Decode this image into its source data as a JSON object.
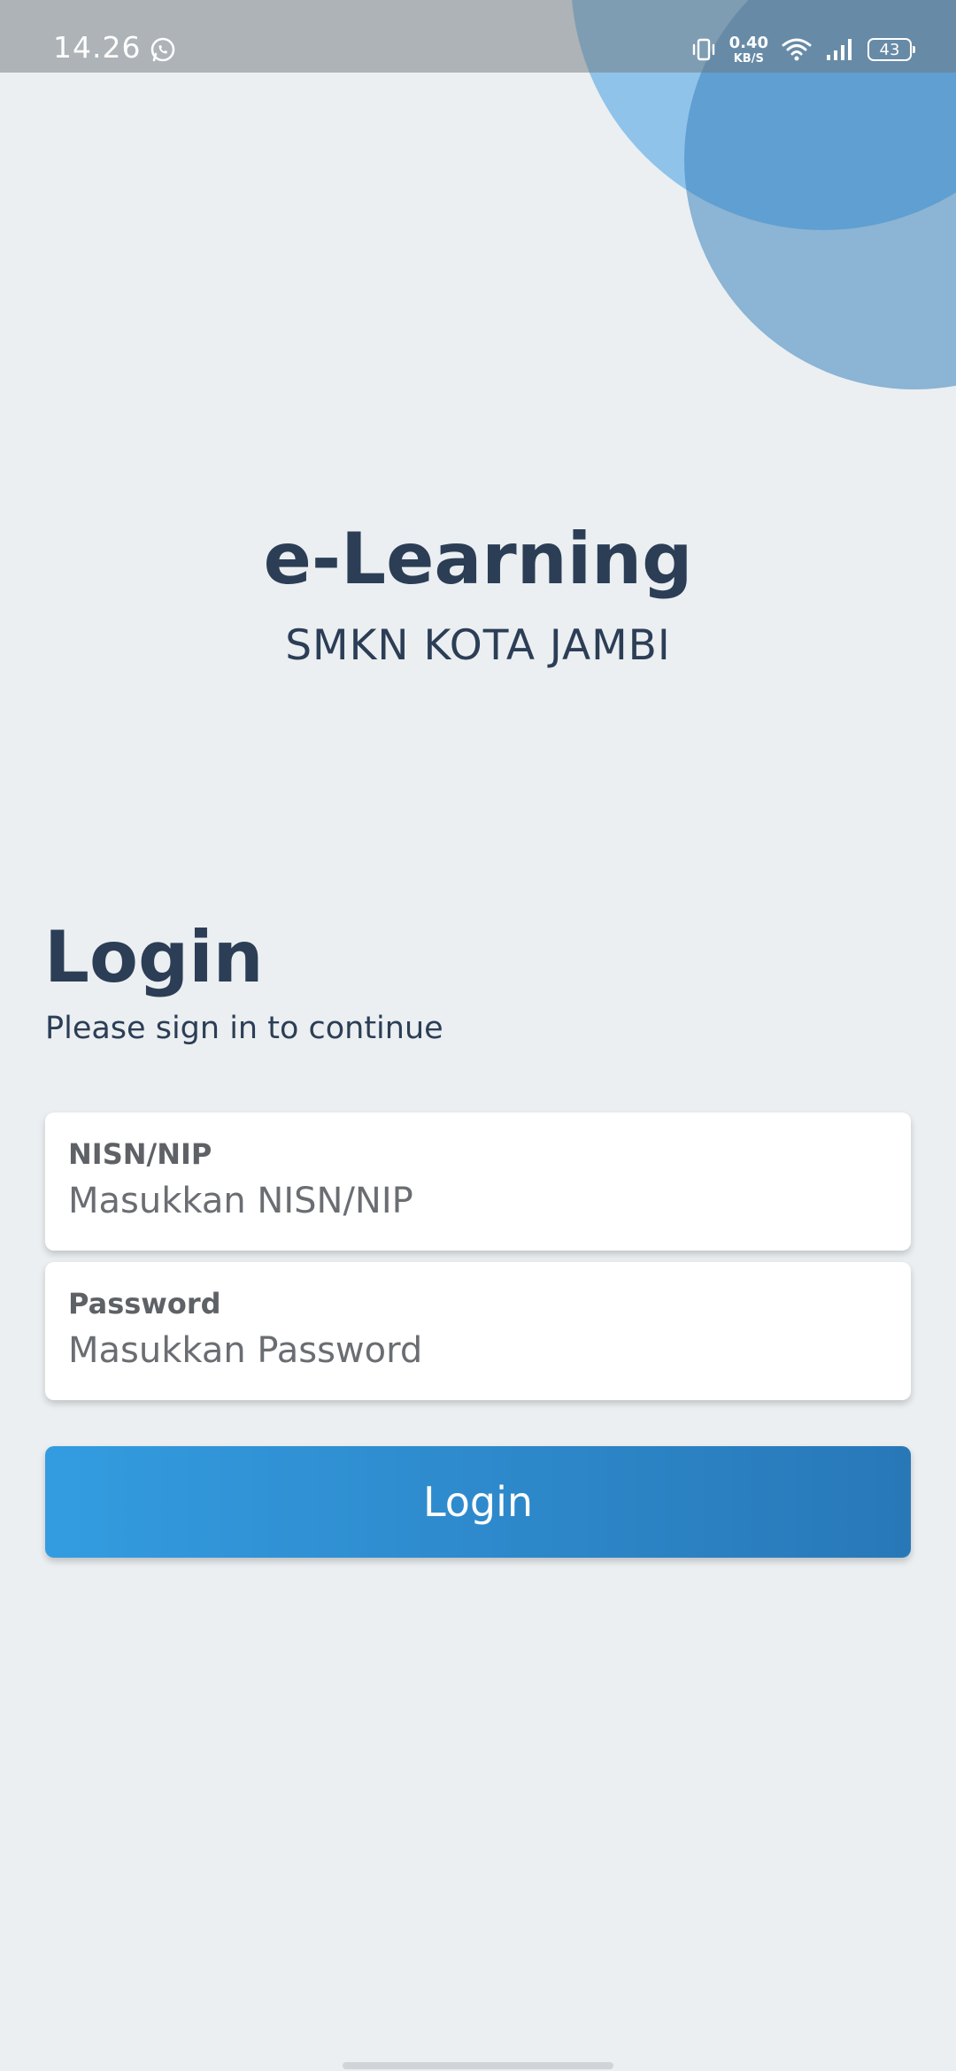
{
  "status_bar": {
    "time": "14.26",
    "left_icon": "whatsapp-icon",
    "net_speed_value": "0.40",
    "net_speed_unit": "KB/S",
    "battery_level": "43",
    "icons": [
      "vibrate-icon",
      "wifi-icon",
      "signal-icon",
      "battery-icon"
    ]
  },
  "brand": {
    "title": "e-Learning",
    "subtitle": "SMKN KOTA JAMBI"
  },
  "login": {
    "heading": "Login",
    "subheading": "Please sign in to continue",
    "nisn": {
      "label": "NISN/NIP",
      "placeholder": "Masukkan NISN/NIP",
      "value": ""
    },
    "password": {
      "label": "Password",
      "placeholder": "Masukkan Password",
      "value": ""
    },
    "button_label": "Login"
  },
  "colors": {
    "background": "#ebeff1",
    "text_primary": "#2c3e56",
    "accent_start": "#339ce0",
    "accent_end": "#2878b8",
    "circle_light": "#8fc3e9",
    "circle_dark": "#5a9fcf"
  }
}
